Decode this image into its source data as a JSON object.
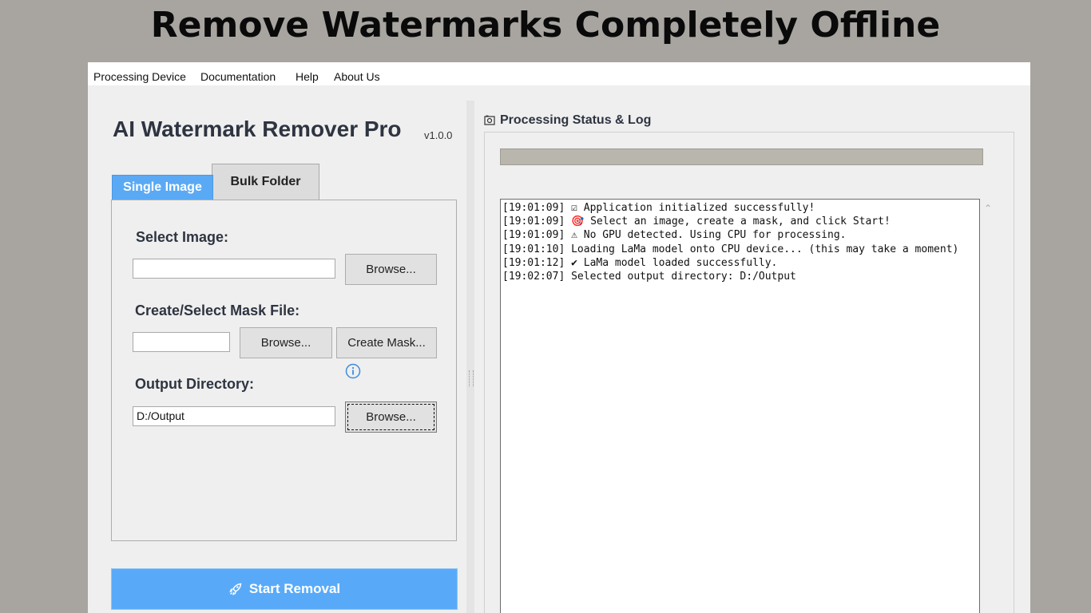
{
  "banner": {
    "text": "Remove Watermarks Completely Offline"
  },
  "menu": {
    "items": [
      "Processing Device",
      "Documentation",
      "Help",
      "About Us"
    ]
  },
  "app": {
    "title": "AI Watermark Remover Pro",
    "version": "v1.0.0"
  },
  "tabs": {
    "single": "Single Image",
    "bulk": "Bulk Folder",
    "active": "Single Image"
  },
  "single_image": {
    "select_image_label": "Select Image:",
    "select_image_value": "",
    "browse_label": "Browse...",
    "mask_label": "Create/Select Mask File:",
    "mask_value": "",
    "mask_browse_label": "Browse...",
    "create_mask_label": "Create Mask...",
    "output_label": "Output Directory:",
    "output_value": "D:/Output",
    "output_browse_label": "Browse..."
  },
  "start_button": {
    "label": "Start Removal",
    "icon": "rocket-icon"
  },
  "status": {
    "title": "Processing Status & Log",
    "progress": 0,
    "log": [
      "[19:01:09] ☑ Application initialized successfully!",
      "[19:01:09] 🎯 Select an image, create a mask, and click Start!",
      "[19:01:09] ⚠ No GPU detected. Using CPU for processing.",
      "[19:01:10] Loading LaMa model onto CPU device... (this may take a moment)",
      "[19:01:12] ✔ LaMa model loaded successfully.",
      "[19:02:07] Selected output directory: D:/Output"
    ]
  },
  "colors": {
    "accent": "#58aaf9",
    "background": "#a8a5a1",
    "window": "#efefef"
  }
}
